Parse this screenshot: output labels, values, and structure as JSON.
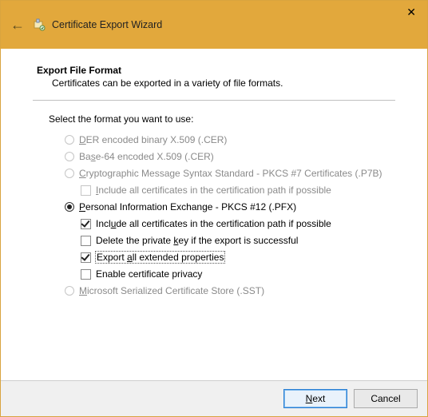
{
  "titlebar": {
    "title": "Certificate Export Wizard"
  },
  "page": {
    "heading": "Export File Format",
    "subheading": "Certificates can be exported in a variety of file formats.",
    "prompt": "Select the format you want to use:"
  },
  "options": {
    "der": {
      "prefix": "D",
      "rest": "ER encoded binary X.509 (.CER)"
    },
    "base64": {
      "prefix": "",
      "rest": "Ba",
      "u": "s",
      "rest2": "e-64 encoded X.509 (.CER)"
    },
    "pkcs7": {
      "u": "C",
      "rest": "ryptographic Message Syntax Standard - PKCS #7 Certificates (.P7B)"
    },
    "pkcs7_sub": {
      "u": "I",
      "rest": "nclude all certificates in the certification path if possible"
    },
    "pfx": {
      "u": "P",
      "rest": "ersonal Information Exchange - PKCS #12 (.PFX)"
    },
    "pfx_sub1": {
      "prefix": "Incl",
      "u": "u",
      "rest": "de all certificates in the certification path if possible"
    },
    "pfx_sub2": {
      "prefix": "Delete the private ",
      "u": "k",
      "rest": "ey if the export is successful"
    },
    "pfx_sub3": {
      "prefix": "Export ",
      "u": "a",
      "rest": "ll extended properties"
    },
    "pfx_sub4": {
      "label": "Enable certificate privacy"
    },
    "sst": {
      "u": "M",
      "rest": "icrosoft Serialized Certificate Store (.SST)"
    }
  },
  "buttons": {
    "next_u": "N",
    "next_rest": "ext",
    "cancel": "Cancel"
  }
}
